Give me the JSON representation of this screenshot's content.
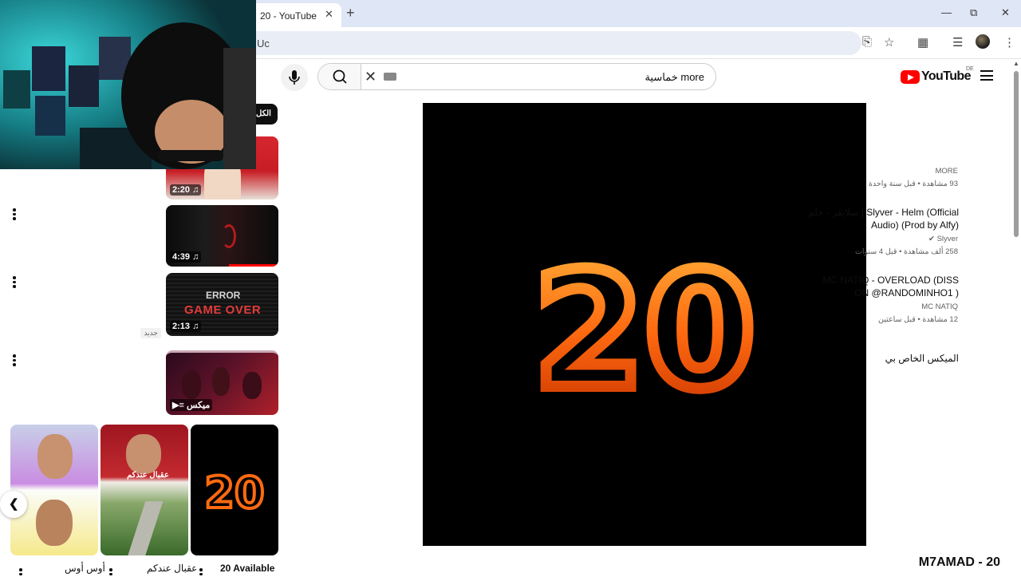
{
  "browser": {
    "tab_title": "20 - YouTube",
    "url_text": "Uc",
    "tab_close": "✕",
    "new_tab": "+"
  },
  "youtube": {
    "logo_text": "YouTube",
    "region": "DE",
    "search_query": "more خماسية"
  },
  "chip": {
    "label": "الكل"
  },
  "player": {
    "art_text": "20"
  },
  "video_title": "M7AMAD - 20",
  "related": [
    {
      "title": "",
      "channel": "MORE",
      "stats": "93 مشاهدة • قبل سنة واحدة",
      "duration": "2:20"
    },
    {
      "title": "سلايفر - حلم | Slyver - Helm (Official Audio) (Prod by Alfy)",
      "channel": "Slyver",
      "stats": "258 ألف مشاهدة • قبل 4 سنوات",
      "duration": "4:39"
    },
    {
      "title": "MC NATIQ - OVERLOAD (DISS ON @RANDOMINHO1 )",
      "channel": "MC NATIQ",
      "stats": "12 مشاهدة • قبل ساعتين",
      "badge": "جديد",
      "duration": "2:13",
      "thumb_text_1": "ERROR",
      "thumb_text_2": "GAME OVER"
    },
    {
      "title": "الميكس الخاص بي",
      "duration": "ميكس"
    }
  ],
  "shorts": [
    {
      "title": "أوس أوس"
    },
    {
      "title": "عقبال عندكم",
      "thumb_text": "عقبال عندكم"
    },
    {
      "title": "20 Available",
      "thumb_text": "20"
    }
  ]
}
